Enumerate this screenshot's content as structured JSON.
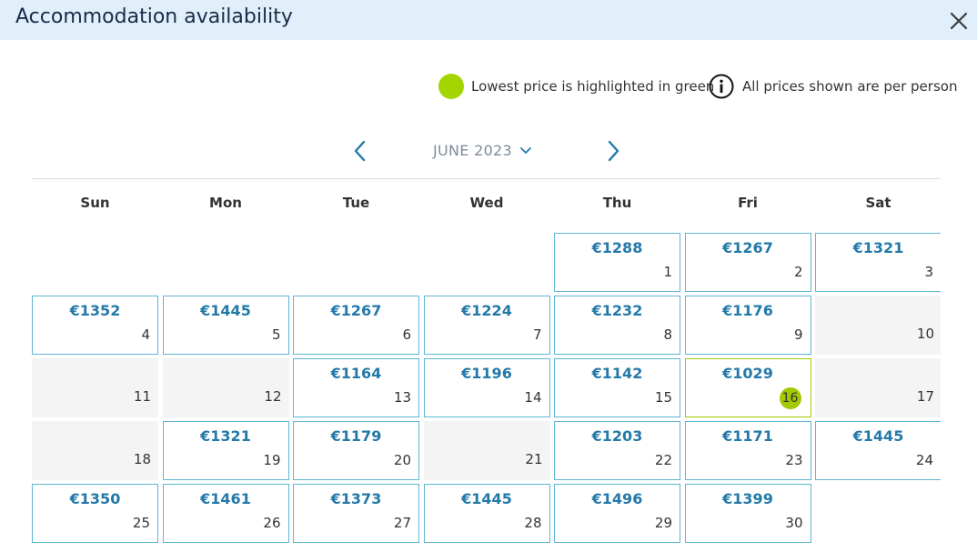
{
  "header": {
    "title": "Accommodation availability"
  },
  "legend": {
    "lowest_text": "Lowest price is highlighted in green",
    "per_person_text": "All prices shown are per person"
  },
  "month_nav": {
    "label": "JUNE 2023"
  },
  "weekdays": [
    "Sun",
    "Mon",
    "Tue",
    "Wed",
    "Thu",
    "Fri",
    "Sat"
  ],
  "colors": {
    "accent": "#2379a8",
    "lowest": "#a3c900",
    "border": "#5fb7d4",
    "unavailable": "#f4f4f4"
  },
  "days": [
    {
      "day": "1",
      "price": "€1288",
      "status": "available"
    },
    {
      "day": "2",
      "price": "€1267",
      "status": "available"
    },
    {
      "day": "3",
      "price": "€1321",
      "status": "available"
    },
    {
      "day": "4",
      "price": "€1352",
      "status": "available"
    },
    {
      "day": "5",
      "price": "€1445",
      "status": "available"
    },
    {
      "day": "6",
      "price": "€1267",
      "status": "available"
    },
    {
      "day": "7",
      "price": "€1224",
      "status": "available"
    },
    {
      "day": "8",
      "price": "€1232",
      "status": "available"
    },
    {
      "day": "9",
      "price": "€1176",
      "status": "available"
    },
    {
      "day": "10",
      "price": "",
      "status": "unavailable"
    },
    {
      "day": "11",
      "price": "",
      "status": "unavailable"
    },
    {
      "day": "12",
      "price": "",
      "status": "unavailable"
    },
    {
      "day": "13",
      "price": "€1164",
      "status": "available"
    },
    {
      "day": "14",
      "price": "€1196",
      "status": "available"
    },
    {
      "day": "15",
      "price": "€1142",
      "status": "available"
    },
    {
      "day": "16",
      "price": "€1029",
      "status": "lowest"
    },
    {
      "day": "17",
      "price": "",
      "status": "unavailable"
    },
    {
      "day": "18",
      "price": "",
      "status": "unavailable"
    },
    {
      "day": "19",
      "price": "€1321",
      "status": "available"
    },
    {
      "day": "20",
      "price": "€1179",
      "status": "available"
    },
    {
      "day": "21",
      "price": "",
      "status": "unavailable"
    },
    {
      "day": "22",
      "price": "€1203",
      "status": "available"
    },
    {
      "day": "23",
      "price": "€1171",
      "status": "available"
    },
    {
      "day": "24",
      "price": "€1445",
      "status": "available"
    },
    {
      "day": "25",
      "price": "€1350",
      "status": "available"
    },
    {
      "day": "26",
      "price": "€1461",
      "status": "available"
    },
    {
      "day": "27",
      "price": "€1373",
      "status": "available"
    },
    {
      "day": "28",
      "price": "€1445",
      "status": "available"
    },
    {
      "day": "29",
      "price": "€1496",
      "status": "available"
    },
    {
      "day": "30",
      "price": "€1399",
      "status": "available"
    }
  ]
}
